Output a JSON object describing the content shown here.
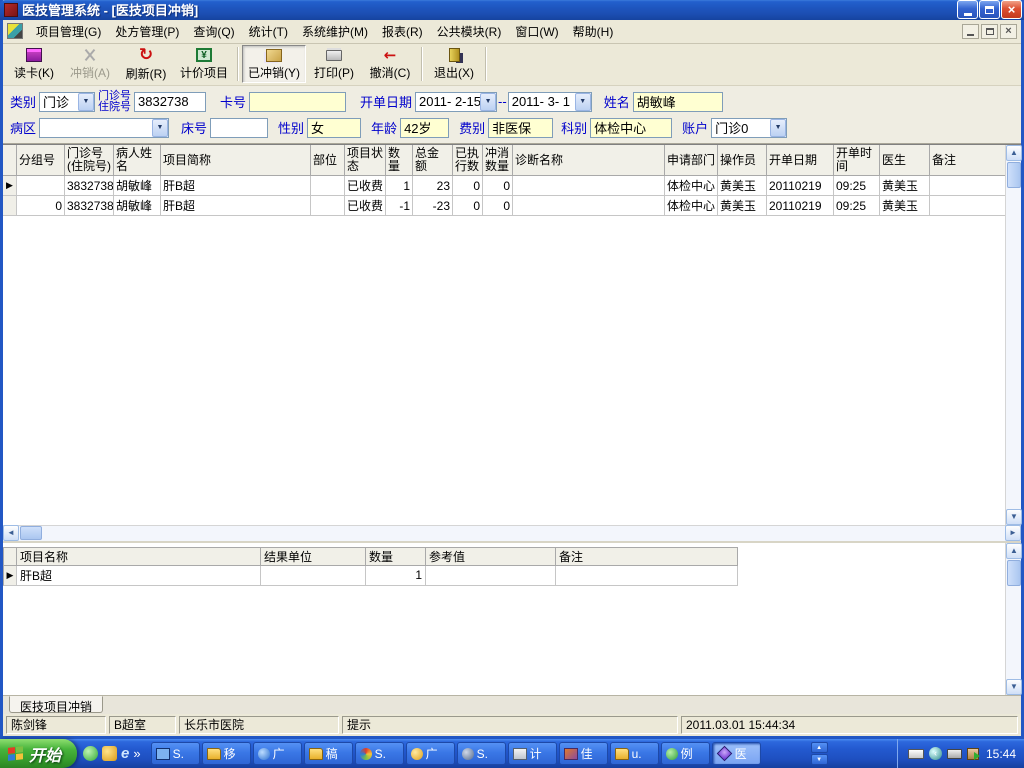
{
  "window": {
    "title": "医技管理系统 - [医技项目冲销]"
  },
  "menu": {
    "items": [
      "项目管理(G)",
      "处方管理(P)",
      "查询(Q)",
      "统计(T)",
      "系统维护(M)",
      "报表(R)",
      "公共模块(R)",
      "窗口(W)",
      "帮助(H)"
    ]
  },
  "toolbar": {
    "buttons": [
      {
        "label": "读卡(K)",
        "icon": "card-reader-icon",
        "state": "normal"
      },
      {
        "label": "冲销(A)",
        "icon": "scissors-icon",
        "state": "disabled"
      },
      {
        "label": "刷新(R)",
        "icon": "refresh-icon",
        "state": "normal"
      },
      {
        "label": "计价项目",
        "icon": "price-items-icon",
        "state": "normal"
      },
      {
        "label": "已冲销(Y)",
        "icon": "written-off-icon",
        "state": "pressed"
      },
      {
        "label": "打印(P)",
        "icon": "printer-icon",
        "state": "normal"
      },
      {
        "label": "撤消(C)",
        "icon": "undo-icon",
        "state": "normal"
      },
      {
        "label": "退出(X)",
        "icon": "exit-icon",
        "state": "normal"
      }
    ]
  },
  "filters": {
    "type_label": "类别",
    "type_value": "门诊",
    "visitno_label1": "门诊号",
    "visitno_label2": "住院号",
    "visitno_value": "3832738",
    "card_label": "卡号",
    "card_value": "",
    "date_label": "开单日期",
    "date_from": "2011- 2-15",
    "date_sep": "--",
    "date_to": "2011- 3- 1",
    "name_label": "姓名",
    "name_value": "胡敏峰",
    "ward_label": "病区",
    "ward_value": "",
    "bed_label": "床号",
    "bed_value": "",
    "sex_label": "性别",
    "sex_value": "女",
    "age_label": "年龄",
    "age_value": "42岁",
    "fee_label": "费别",
    "fee_value": "非医保",
    "dept_label": "科别",
    "dept_value": "体检中心",
    "account_label": "账户",
    "account_value": "门诊0"
  },
  "grid": {
    "columns": [
      "",
      "分组号",
      "门诊号(住院号)",
      "病人姓名",
      "项目简称",
      "部位",
      "项目状态",
      "数量",
      "总金额",
      "已执行数",
      "冲消数量",
      "诊断名称",
      "申请部门",
      "操作员",
      "开单日期",
      "开单时间",
      "医生",
      "备注"
    ],
    "rows": [
      {
        "cells": [
          "",
          "",
          "3832738",
          "胡敏峰",
          "肝B超",
          "",
          "已收费",
          "1",
          "23",
          "0",
          "0",
          "",
          "体检中心",
          "黄美玉",
          "20110219",
          "09:25",
          "黄美玉",
          ""
        ]
      },
      {
        "cells": [
          "",
          "0",
          "3832738",
          "胡敏峰",
          "肝B超",
          "",
          "已收费",
          "-1",
          "-23",
          "0",
          "0",
          "",
          "体检中心",
          "黄美玉",
          "20110219",
          "09:25",
          "黄美玉",
          ""
        ]
      }
    ]
  },
  "detail": {
    "columns": [
      "项目名称",
      "结果单位",
      "数量",
      "参考值",
      "备注"
    ],
    "rows": [
      {
        "cells": [
          "肝B超",
          "",
          "1",
          "",
          ""
        ]
      }
    ]
  },
  "tabs": {
    "active": "医技项目冲销"
  },
  "statusbar": {
    "user": "陈剑锋",
    "dept": "B超室",
    "hospital": "长乐市医院",
    "hint_label": "提示",
    "datetime": "2011.03.01 15:44:34"
  },
  "taskbar": {
    "start_label": "开始",
    "chevron": "»",
    "buttons": [
      {
        "label": "S.",
        "icon": "display-window-icon"
      },
      {
        "label": "移",
        "icon": "folder-icon"
      },
      {
        "label": "广",
        "icon": "ie-icon"
      },
      {
        "label": "稿",
        "icon": "folder-icon"
      },
      {
        "label": "S.",
        "icon": "pinwheel-icon"
      },
      {
        "label": "广",
        "icon": "yellow-app-icon"
      },
      {
        "label": "S.",
        "icon": "compass-icon"
      },
      {
        "label": "计",
        "icon": "calculator-icon"
      },
      {
        "label": "佳",
        "icon": "paint-icon"
      },
      {
        "label": "u.",
        "icon": "folder-icon"
      },
      {
        "label": "例",
        "icon": "clover-icon"
      },
      {
        "label": "医",
        "icon": "meditech-icon",
        "active": true
      }
    ],
    "clock": "15:44"
  },
  "icons": {
    "dropdown": "▼",
    "row_marker": "▶",
    "scroll_up": "▲",
    "scroll_down": "▼",
    "scroll_left": "◄",
    "scroll_right": "►",
    "refresh": "↻",
    "undo": "←",
    "price_symbol": "¥",
    "lang_glyph": "‹"
  }
}
